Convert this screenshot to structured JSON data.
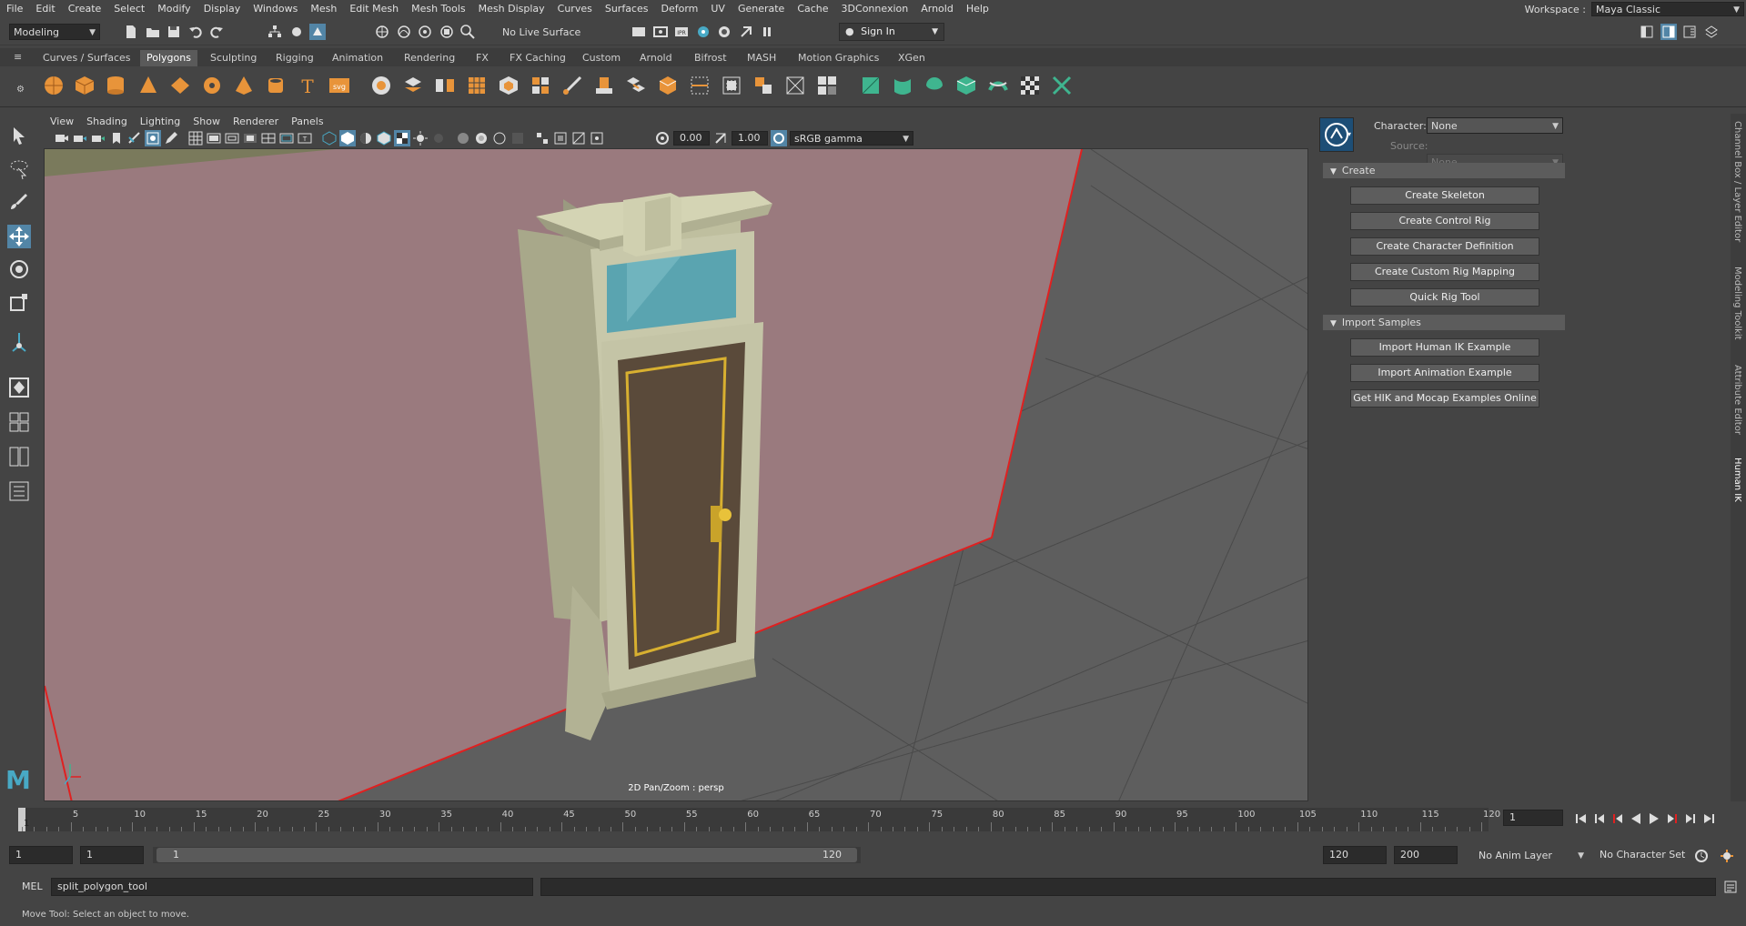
{
  "menus": [
    "File",
    "Edit",
    "Create",
    "Select",
    "Modify",
    "Display",
    "Windows",
    "Mesh",
    "Edit Mesh",
    "Mesh Tools",
    "Mesh Display",
    "Curves",
    "Surfaces",
    "Deform",
    "UV",
    "Generate",
    "Cache",
    "3DConnexion",
    "Arnold",
    "Help"
  ],
  "workspace": {
    "label": "Workspace :",
    "value": "Maya Classic"
  },
  "status_line": {
    "menu_set": "Modeling",
    "live_surface": "No Live Surface",
    "sign_in": "Sign In"
  },
  "shelf_tabs": [
    "Curves / Surfaces",
    "Polygons",
    "Sculpting",
    "Rigging",
    "Animation",
    "Rendering",
    "FX",
    "FX Caching",
    "Custom",
    "Arnold",
    "Bifrost",
    "MASH",
    "Motion Graphics",
    "XGen"
  ],
  "active_shelf": "Polygons",
  "viewport": {
    "menus": [
      "View",
      "Shading",
      "Lighting",
      "Show",
      "Renderer",
      "Panels"
    ],
    "exposure": "0.00",
    "gamma": "1.00",
    "color_space": "sRGB gamma",
    "label": "2D Pan/Zoom : persp"
  },
  "human_ik": {
    "character_label": "Character:",
    "character_value": "None",
    "source_label": "Source:",
    "source_value": "None",
    "create_section": "Create",
    "create_buttons": [
      "Create Skeleton",
      "Create Control Rig",
      "Create Character Definition",
      "Create Custom Rig Mapping",
      "Quick Rig Tool"
    ],
    "import_section": "Import Samples",
    "import_buttons": [
      "Import Human IK Example",
      "Import Animation Example",
      "Get HIK and Mocap Examples Online"
    ]
  },
  "side_tabs": [
    "Channel Box / Layer Editor",
    "Modeling Toolkit",
    "Attribute Editor",
    "Human IK"
  ],
  "timeline": {
    "ticks": [
      1,
      5,
      10,
      15,
      20,
      25,
      30,
      35,
      40,
      45,
      50,
      55,
      60,
      65,
      70,
      75,
      80,
      85,
      90,
      95,
      100,
      105,
      110,
      115,
      120
    ],
    "current_frame": "1"
  },
  "range": {
    "start": "1",
    "inner_start": "1",
    "slider_start": "1",
    "slider_end": "120",
    "inner_end": "120",
    "end": "200",
    "anim_layer": "No Anim Layer",
    "character_set": "No Character Set"
  },
  "command": {
    "language": "MEL",
    "input": "split_polygon_tool"
  },
  "help_line": "Move Tool: Select an object to move.",
  "colors": {
    "accent": "#5285a6",
    "wall": "#9a7a7e",
    "shelf_orange": "#e8943a",
    "shelf_green": "#3fb58f"
  }
}
